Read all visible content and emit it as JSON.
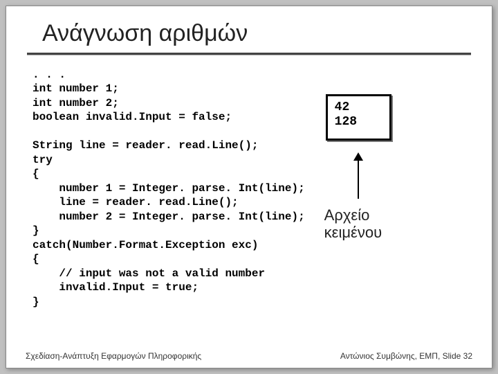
{
  "title": "Ανάγνωση αριθμών",
  "code": ". . .\nint number 1;\nint number 2;\nboolean invalid.Input = false;\n\nString line = reader. read.Line();\ntry\n{\n    number 1 = Integer. parse. Int(line);\n    line = reader. read.Line();\n    number 2 = Integer. parse. Int(line);\n}\ncatch(Number.Format.Exception exc)\n{\n    // input was not a valid number\n    invalid.Input = true;\n}",
  "file": {
    "line1": "42",
    "line2": "128"
  },
  "label": "Αρχείο\nκειμένου",
  "footer": {
    "left": "Σχεδίαση-Ανάπτυξη Εφαρμογών Πληροφορικής",
    "right": "Αντώνιος Συμβώνης, ΕΜΠ, Slide 32"
  }
}
